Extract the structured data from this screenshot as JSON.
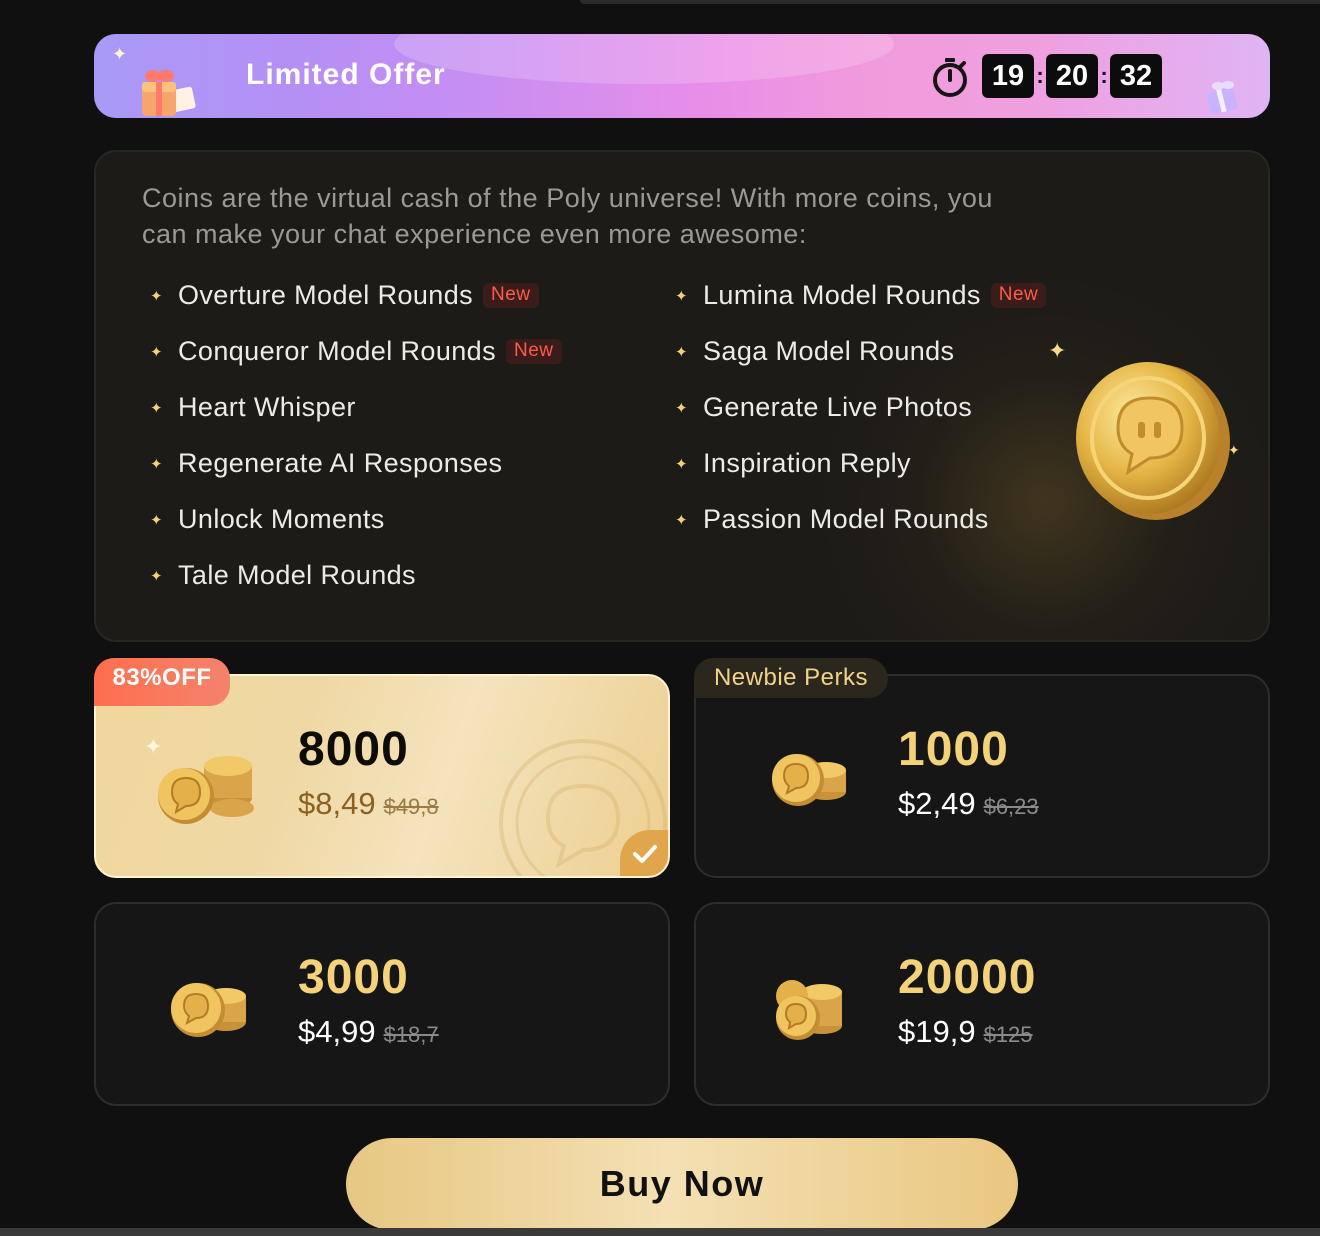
{
  "banner": {
    "title": "Limited Offer",
    "timer": {
      "hours": "19",
      "minutes": "20",
      "seconds": "32"
    }
  },
  "intro": "Coins are the virtual cash of the Poly universe! With more coins, you can make your chat experience even more awesome:",
  "badge_new": "New",
  "features_left": [
    {
      "label": "Overture Model Rounds",
      "new": true
    },
    {
      "label": "Conqueror Model Rounds",
      "new": true
    },
    {
      "label": "Heart Whisper",
      "new": false
    },
    {
      "label": "Regenerate AI Responses",
      "new": false
    },
    {
      "label": "Unlock Moments",
      "new": false
    },
    {
      "label": "Tale Model Rounds",
      "new": false
    }
  ],
  "features_right": [
    {
      "label": "Lumina Model Rounds",
      "new": true
    },
    {
      "label": "Saga Model Rounds",
      "new": false
    },
    {
      "label": "Generate Live Photos",
      "new": false
    },
    {
      "label": "Inspiration Reply",
      "new": false
    },
    {
      "label": "Passion Model Rounds",
      "new": false
    }
  ],
  "packages": [
    {
      "amount": "8000",
      "price": "$8,49",
      "old_price": "$49,8",
      "badge": "83%OFF",
      "selected": true
    },
    {
      "amount": "1000",
      "price": "$2,49",
      "old_price": "$6,23",
      "badge": "Newbie Perks",
      "selected": false
    },
    {
      "amount": "3000",
      "price": "$4,99",
      "old_price": "$18,7",
      "selected": false
    },
    {
      "amount": "20000",
      "price": "$19,9",
      "old_price": "$125",
      "selected": false
    }
  ],
  "buy_label": "Buy Now",
  "colors": {
    "gold": "#f3d27a",
    "badge_red": "#ff5a4a",
    "selected_bg": "#efd8a4"
  }
}
